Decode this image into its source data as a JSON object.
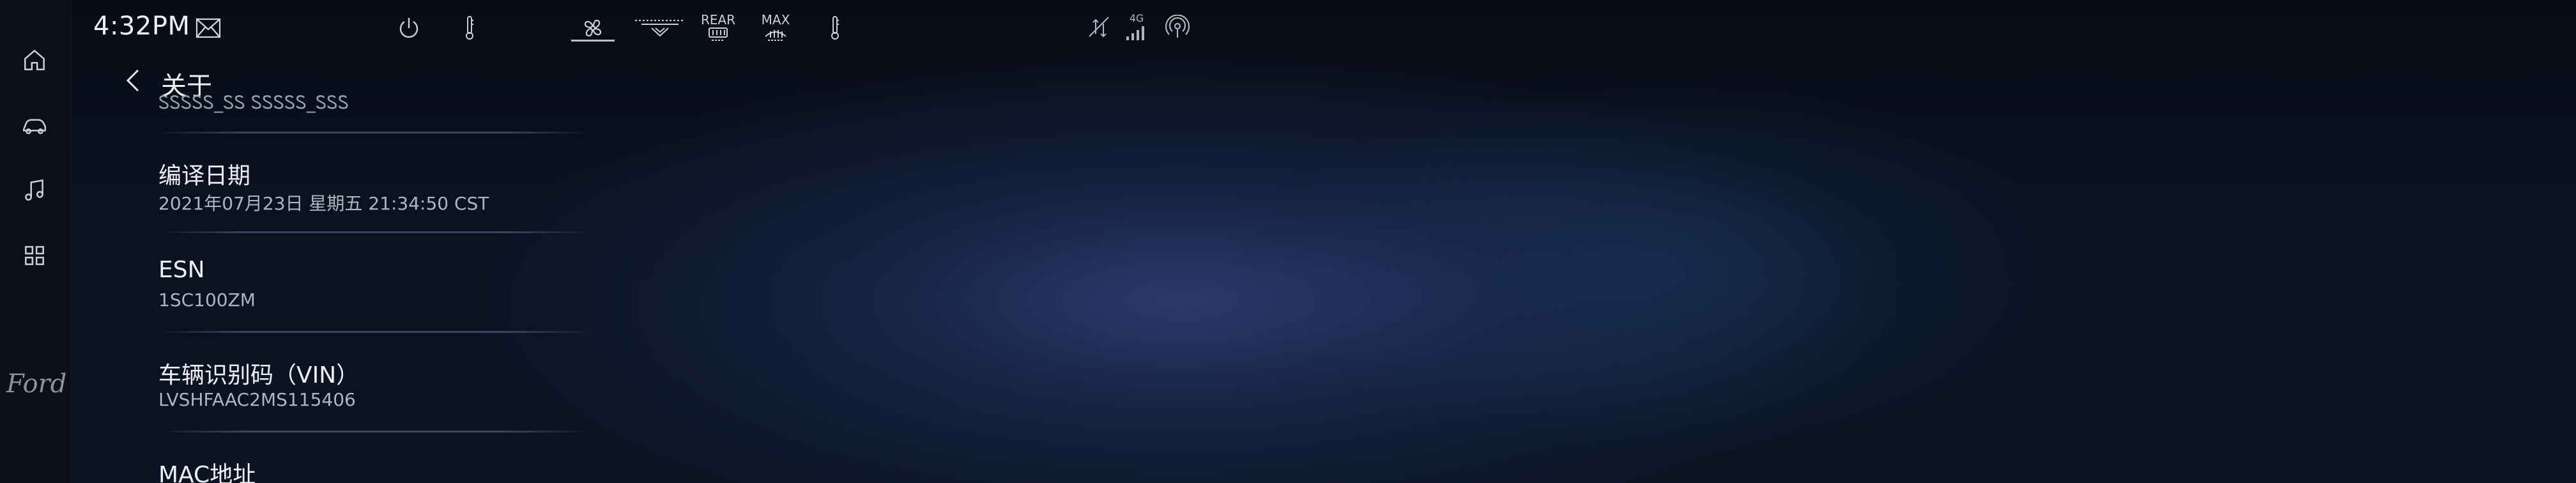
{
  "status_bar": {
    "time": "4:32PM",
    "climate": {
      "rear_label": "REAR",
      "max_label": "MAX"
    },
    "network_label": "4G"
  },
  "sidebar": {
    "brand": "Ford",
    "items": [
      {
        "icon": "home-icon"
      },
      {
        "icon": "car-icon"
      },
      {
        "icon": "music-icon"
      },
      {
        "icon": "apps-grid-icon"
      }
    ]
  },
  "page": {
    "title": "关于",
    "partial_top_value": "ᏚᏚᏚᏚᏚ_ᏚᏚ ᏚᏚᏚᏚᏚ_ᏚᏚᏚ",
    "rows": [
      {
        "label": "编译日期",
        "value": "2021年07月23日 星期五 21:34:50 CST"
      },
      {
        "label": "ESN",
        "value": "1SC100ZM"
      },
      {
        "label": "车辆识别码（VIN）",
        "value": "LVSHFAAC2MS115406"
      },
      {
        "label": "MAC地址",
        "value": ""
      }
    ]
  },
  "colors": {
    "sidebar_bg": "#0b0f16",
    "text_primary": "#eef2f7",
    "text_secondary": "#aeb5c2",
    "glow_blue": "#465aaa"
  }
}
